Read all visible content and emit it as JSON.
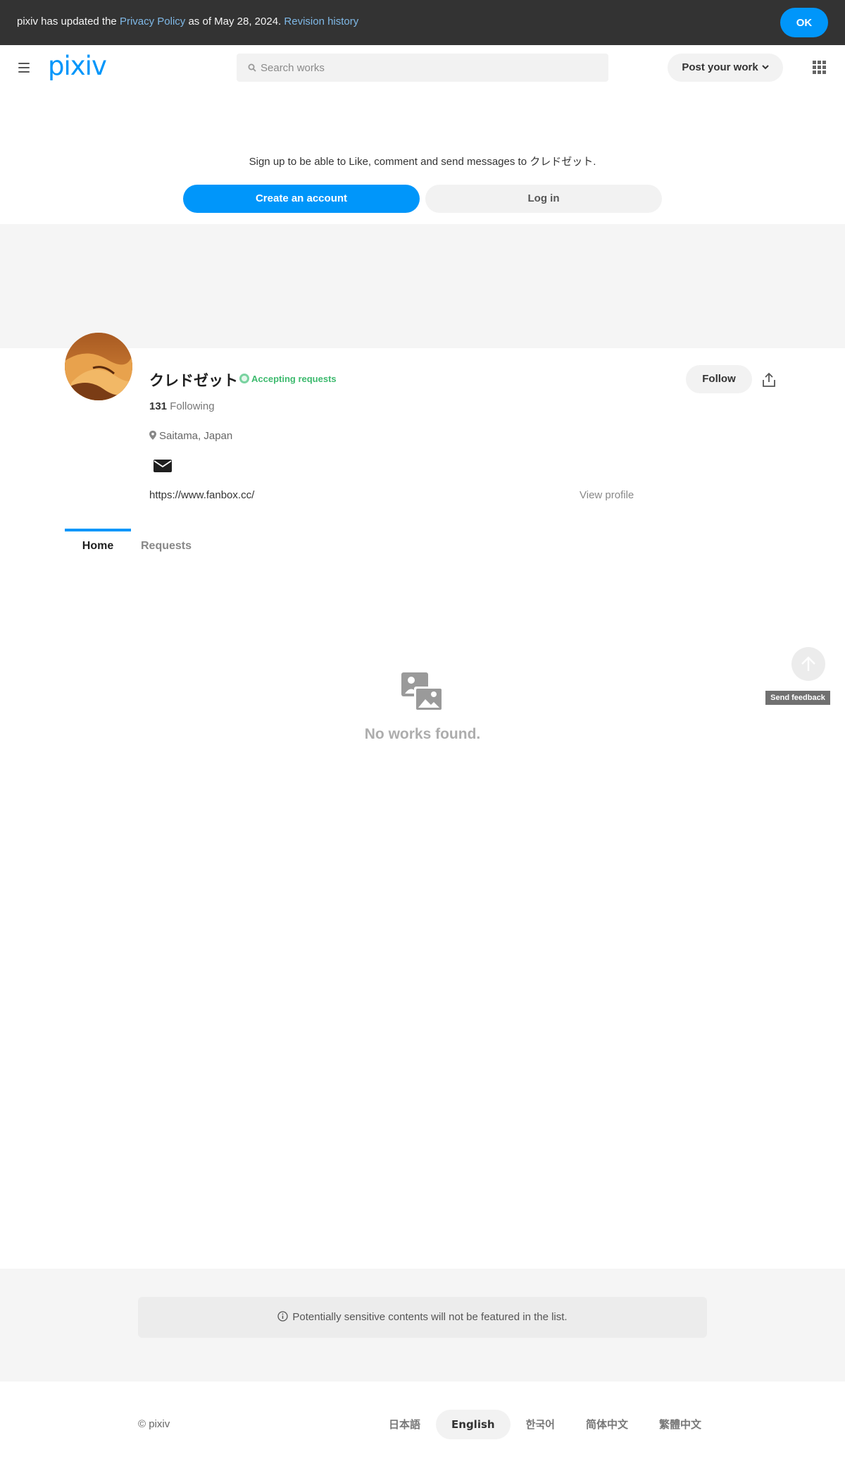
{
  "notice": {
    "prefix": "pixiv has updated the ",
    "privacy_link": "Privacy Policy",
    "middle": " as of May 28, 2024. ",
    "revision_link": "Revision history",
    "ok_label": "OK"
  },
  "header": {
    "logo": "pixiv",
    "search_placeholder": "Search works",
    "post_label": "Post your work"
  },
  "signup": {
    "message": "Sign up to be able to Like, comment and send messages to クレドゼット.",
    "create_label": "Create an account",
    "login_label": "Log in"
  },
  "profile": {
    "name": "クレドゼット",
    "badge": "Accepting requests",
    "following_count": "131",
    "following_label": " Following",
    "location": "Saitama, Japan",
    "website": "https://www.fanbox.cc/",
    "view_profile": "View profile",
    "follow_label": "Follow"
  },
  "tabs": [
    {
      "label": "Home",
      "active": true
    },
    {
      "label": "Requests",
      "active": false
    }
  ],
  "empty_state": {
    "message": "No works found."
  },
  "floating": {
    "feedback_label": "Send feedback"
  },
  "footer": {
    "sensitive_notice": "Potentially sensitive contents will not be featured in the list.",
    "copyright": "© pixiv",
    "languages": [
      {
        "label": "日本語",
        "active": false
      },
      {
        "label": "English",
        "active": true
      },
      {
        "label": "한국어",
        "active": false
      },
      {
        "label": "简体中文",
        "active": false
      },
      {
        "label": "繁體中文",
        "active": false
      }
    ]
  },
  "colors": {
    "accent": "#0096fa",
    "notice_bg": "#333333",
    "badge_green": "#3dba6e"
  }
}
